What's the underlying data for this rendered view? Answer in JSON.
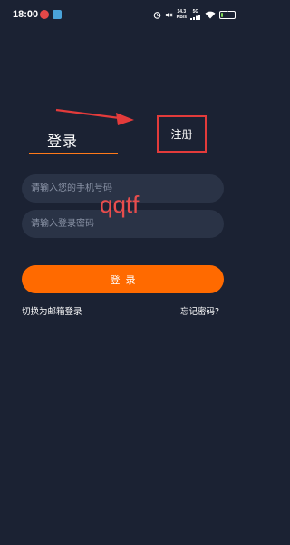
{
  "status_bar": {
    "time": "18:00",
    "speed_value": "14.3",
    "speed_unit": "KB/s",
    "network": "5G",
    "battery_level": "8",
    "battery_fraction": 0.08
  },
  "tabs": {
    "login": "登录",
    "register": "注册"
  },
  "form": {
    "phone_placeholder": "请输入您的手机号码",
    "password_placeholder": "请输入登录密码",
    "login_button": "登录"
  },
  "watermark": "qqtf",
  "links": {
    "email_login": "切换为邮箱登录",
    "forgot_password": "忘记密码?"
  },
  "colors": {
    "background": "#1b2233",
    "accent": "#ff6a00",
    "annotation": "#e33b3b",
    "input_bg": "#2a3346"
  }
}
